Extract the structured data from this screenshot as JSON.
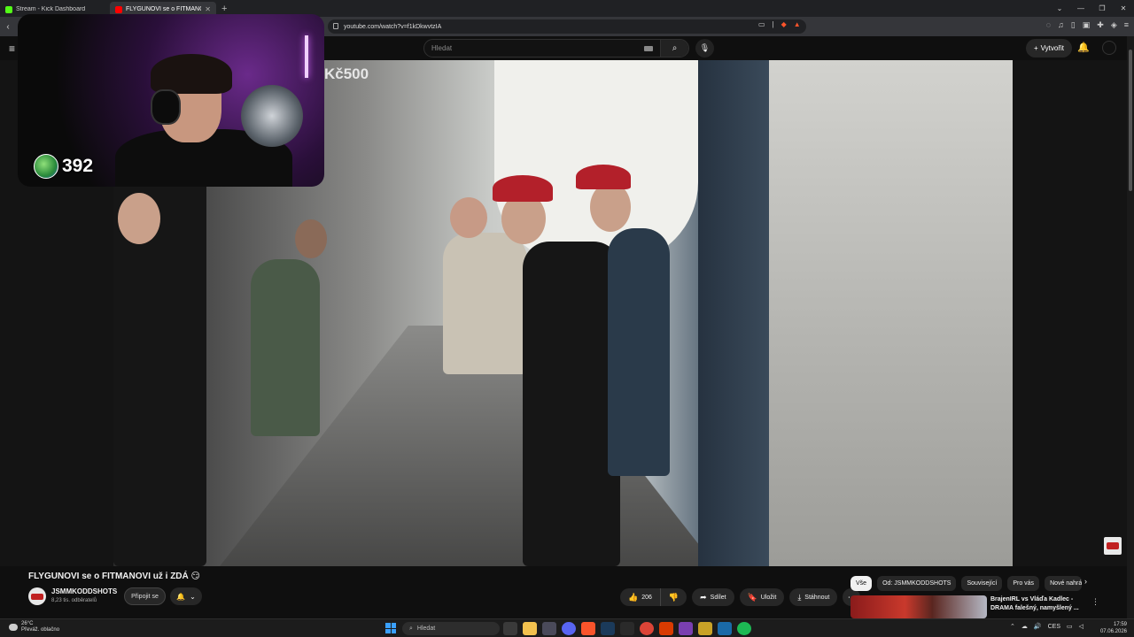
{
  "browser": {
    "tabs": [
      {
        "title": "Stream - Kick Dashboard",
        "active": false,
        "icon_color": "#53fc18"
      },
      {
        "title": "FLYGUNOVI se o FITMANOVI už i",
        "active": true,
        "icon_color": "#ff0000"
      }
    ],
    "new_tab": "+",
    "url": "youtube.com/watch?v=f1kDkwvtzIA"
  },
  "youtube": {
    "search_placeholder": "Hledat",
    "create_label": "Vytvořit"
  },
  "video": {
    "overlay_text": "Kč500",
    "title": "FLYGUNOVI se o FITMANOVI už i ZDÁ 😏",
    "channel_name": "JSMMKODDSHOTS",
    "subscribers": "8,23 tis. odběratelů",
    "join_label": "Připojit se",
    "likes": "206",
    "share_label": "Sdílet",
    "save_label": "Uložit",
    "download_label": "Stáhnout"
  },
  "stream_overlay": {
    "viewer_count": "392"
  },
  "chips": [
    {
      "label": "Vše",
      "selected": true
    },
    {
      "label": "Od: JSMMKODDSHOTS",
      "selected": false
    },
    {
      "label": "Související",
      "selected": false
    },
    {
      "label": "Pro vás",
      "selected": false
    },
    {
      "label": "Nové nahrání",
      "selected": false
    }
  ],
  "recommendation": {
    "title": "BrajenIRL vs Vláďa Kadlec - DRAMA falešný, namyšlený ..."
  },
  "taskbar": {
    "temperature": "26°C",
    "weather": "Převáž. oblačno",
    "search_placeholder": "Hledat",
    "language": "CES",
    "time": "17:59",
    "date": "07.06.2026"
  },
  "colors": {
    "accent_red": "#ff0000",
    "kick_green": "#53fc18"
  }
}
